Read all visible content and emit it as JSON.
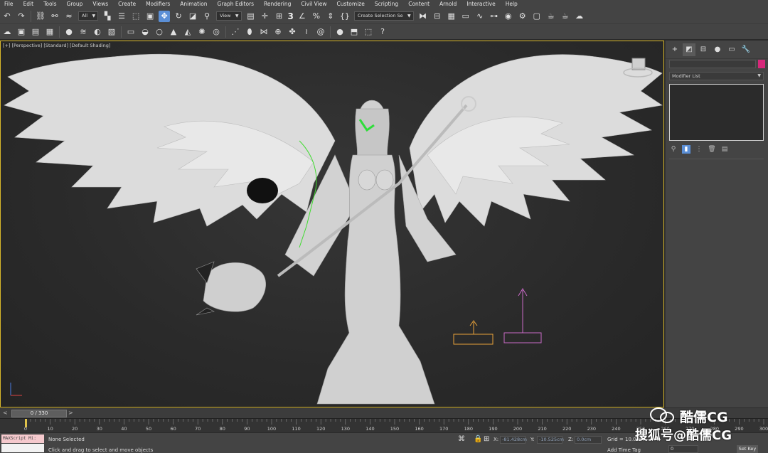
{
  "menu": [
    "File",
    "Edit",
    "Tools",
    "Group",
    "Views",
    "Create",
    "Modifiers",
    "Animation",
    "Graph Editors",
    "Rendering",
    "Civil View",
    "Customize",
    "Scripting",
    "Content",
    "Arnold",
    "Interactive",
    "Help"
  ],
  "toolbar": {
    "selection_filter": "All",
    "ref_coord": "View",
    "snap_num": "3",
    "named_selection": "Create Selection Se"
  },
  "viewport": {
    "label": "[+] [Perspective] [Standard] [Default Shading]"
  },
  "command_panel": {
    "modifier_list": "Modifier List"
  },
  "timeslider": {
    "frame": "0 / 330",
    "prev": "<",
    "next": ">"
  },
  "trackbar": {
    "ticks": [
      "0",
      "10",
      "20",
      "30",
      "40",
      "50",
      "60",
      "70",
      "80",
      "90",
      "100",
      "110",
      "120",
      "130",
      "140",
      "150",
      "160",
      "170",
      "180",
      "190",
      "200",
      "210",
      "220",
      "230",
      "240",
      "250",
      "260",
      "270",
      "280",
      "290",
      "300"
    ]
  },
  "status": {
    "maxscript": "MAXScript Mi:",
    "selection": "None Selected",
    "prompt": "Click and drag to select and move objects",
    "x_label": "X:",
    "x_value": "-81.428cm",
    "y_label": "Y:",
    "y_value": "-10.525cm",
    "z_label": "Z:",
    "z_value": "0.0cm",
    "grid": "Grid = 10.0cm",
    "add_time_tag": "Add Time Tag",
    "key_value": "0",
    "set_key": "Set Key"
  },
  "watermark": {
    "brand": "酷儒CG",
    "source": "搜狐号@酷儒CG"
  },
  "colors": {
    "viewport_border": "#d9b82a",
    "object_color": "#d6287a",
    "active_tool": "#5b8fd6"
  }
}
